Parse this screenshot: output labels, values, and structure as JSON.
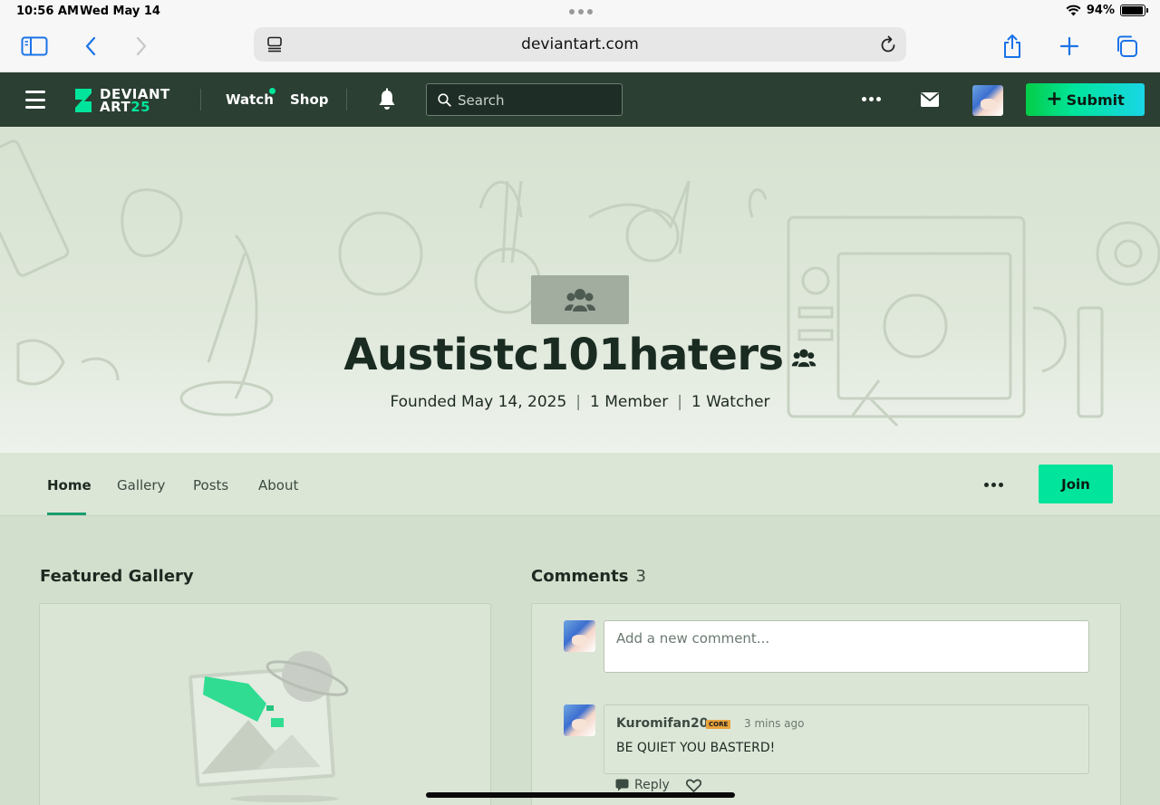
{
  "status_bar": {
    "time": "10:56 AM",
    "date": "Wed May 14",
    "battery": "94%",
    "battery_level": 0.94
  },
  "browser": {
    "url": "deviantart.com",
    "tint_color": "#1a73e8"
  },
  "da_nav": {
    "logo_line1": "DEVIANT",
    "logo_line2_a": "ART",
    "logo_line2_b": "25",
    "watch_label": "Watch",
    "shop_label": "Shop",
    "search_placeholder": "Search",
    "submit_label": "Submit",
    "brand_color": "#00e59b",
    "nav_bg": "#2b3f33"
  },
  "group": {
    "name": "Austistc101haters",
    "founded": "Founded May 14, 2025",
    "members": "1 Member",
    "watchers": "1 Watcher"
  },
  "tabs": {
    "items": [
      {
        "label": "Home",
        "active": true
      },
      {
        "label": "Gallery",
        "active": false
      },
      {
        "label": "Posts",
        "active": false
      },
      {
        "label": "About",
        "active": false
      }
    ],
    "join_label": "Join"
  },
  "featured_gallery": {
    "title": "Featured Gallery"
  },
  "comments": {
    "title": "Comments",
    "count": "3",
    "input_placeholder": "Add a new comment...",
    "items": [
      {
        "author": "Kuromifan20",
        "badge": "CORE",
        "time": "3 mins ago",
        "text": "BE QUIET YOU BASTERD!",
        "reply_label": "Reply"
      }
    ]
  }
}
